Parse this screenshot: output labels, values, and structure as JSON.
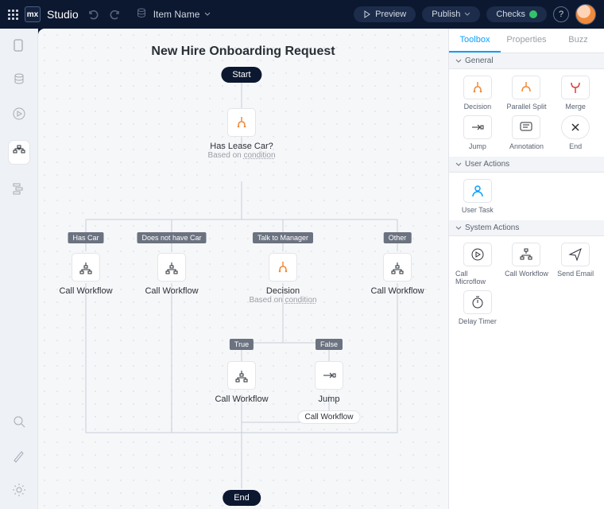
{
  "header": {
    "brand": "Studio",
    "logo_text": "mx",
    "item_label": "Item Name",
    "preview": "Preview",
    "publish": "Publish",
    "checks": "Checks"
  },
  "rtabs": {
    "toolbox": "Toolbox",
    "properties": "Properties",
    "buzz": "Buzz"
  },
  "sections": {
    "general": "General",
    "user_actions": "User Actions",
    "system_actions": "System Actions"
  },
  "tools": {
    "decision": "Decision",
    "parallel_split": "Parallel Split",
    "merge": "Merge",
    "jump": "Jump",
    "annotation": "Annotation",
    "end": "End",
    "user_task": "User Task",
    "call_microflow": "Call Microflow",
    "call_workflow": "Call Workflow",
    "send_email": "Send Email",
    "delay_timer": "Delay Timer"
  },
  "canvas": {
    "title": "New Hire Onboarding Request",
    "start": "Start",
    "end": "End",
    "lease": {
      "label": "Has Lease Car?",
      "sub_pre": "Based on ",
      "sub_link": "condition"
    },
    "decision2": {
      "label": "Decision",
      "sub_pre": "Based on ",
      "sub_link": "condition"
    },
    "branches": {
      "has_car": "Has Car",
      "no_car": "Does not have Car",
      "talk_manager": "Talk to Manager",
      "other": "Other",
      "true": "True",
      "false": "False"
    },
    "call_workflow": "Call Workflow",
    "jump": "Jump",
    "jump_chip": "Call Workflow"
  }
}
